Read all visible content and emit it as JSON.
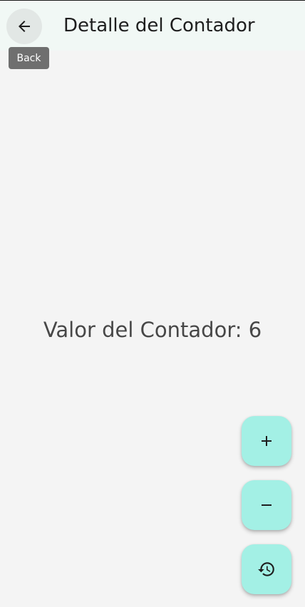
{
  "app_bar": {
    "title": "Detalle del Contador",
    "back_icon": "arrow-back-icon",
    "back_tooltip": "Back"
  },
  "counter": {
    "text": "Valor del Contador: 6",
    "value": 6
  },
  "fabs": {
    "increment_icon": "add-icon",
    "decrement_icon": "remove-icon",
    "reset_icon": "history-icon",
    "color": "#a3f0e5"
  },
  "colors": {
    "app_bar_background": "#f1f8f5",
    "page_background": "#f4f4f4"
  }
}
